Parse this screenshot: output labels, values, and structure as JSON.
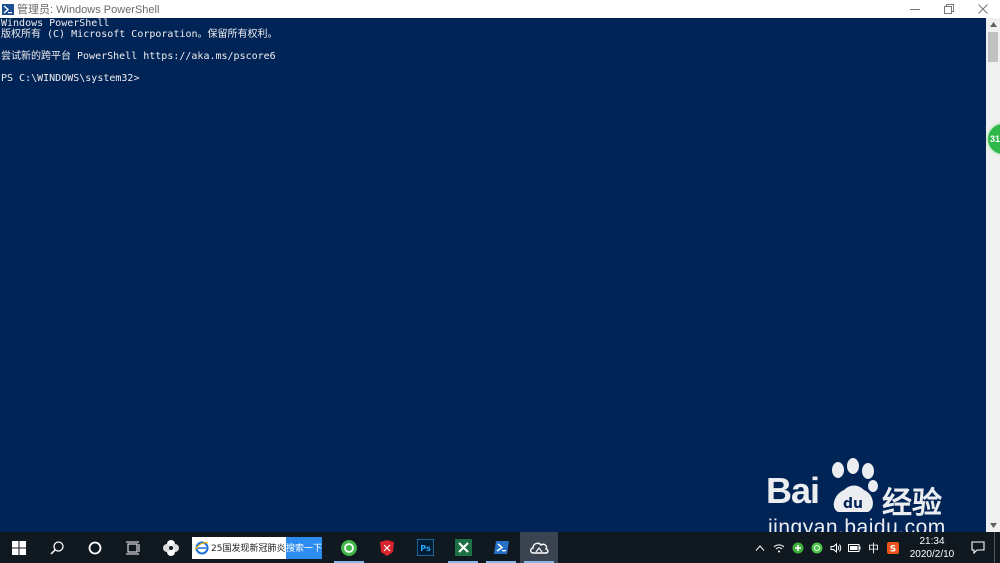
{
  "window": {
    "title": "管理员: Windows PowerShell",
    "controls": [
      "minimize",
      "restore",
      "close"
    ]
  },
  "console": {
    "lines": [
      "Windows PowerShell",
      "版权所有 (C) Microsoft Corporation。保留所有权利。",
      "",
      "尝试新的跨平台 PowerShell https://aka.ms/pscore6",
      "",
      "PS C:\\WINDOWS\\system32>"
    ]
  },
  "side_badge": {
    "text": "31"
  },
  "watermark": {
    "brand": "Bai",
    "brand2": "经验",
    "domain": "jingyan.baidu.com"
  },
  "taskbar": {
    "search": {
      "query": "25国发现新冠肺炎",
      "button_label": "搜索一下"
    },
    "apps": [
      {
        "icon": "gear-app-icon",
        "active": true
      },
      {
        "icon": "red-app-icon",
        "active": false
      },
      {
        "icon": "photoshop-icon",
        "active": false
      },
      {
        "icon": "excel-icon",
        "active": true
      },
      {
        "icon": "powershell-icon",
        "active": true
      },
      {
        "icon": "cloud-app-icon",
        "active": true
      }
    ],
    "tray": {
      "ime": "中",
      "time": "21:34",
      "date": "2020/2/10"
    }
  },
  "colors": {
    "console_bg": "#012456",
    "console_fg": "#eeedf0",
    "taskbar_bg": "#101820",
    "search_button": "#2d8cf0"
  }
}
